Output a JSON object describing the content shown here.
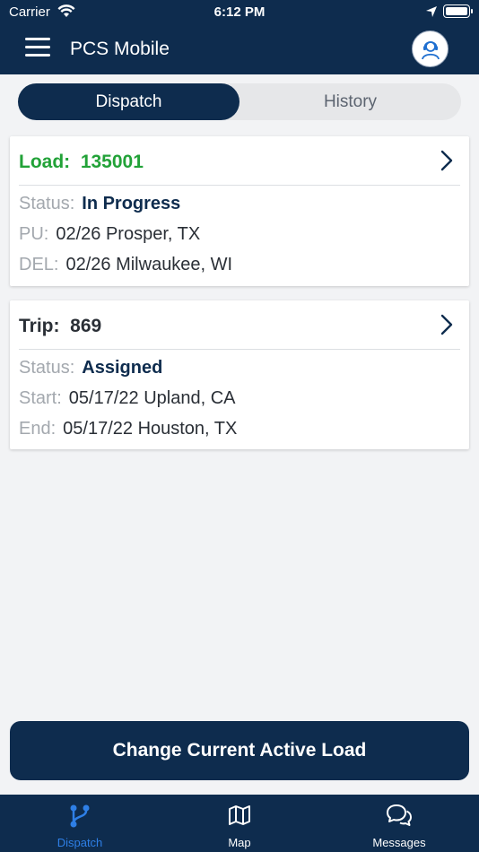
{
  "status_bar": {
    "carrier": "Carrier",
    "time": "6:12 PM"
  },
  "header": {
    "title": "PCS Mobile",
    "menu_icon": "hamburger-icon",
    "profile_icon": "user-support-icon"
  },
  "segments": {
    "dispatch": "Dispatch",
    "history": "History",
    "selected": "Dispatch"
  },
  "load_card": {
    "title_label": "Load:",
    "title_value": "135001",
    "title_color": "#22a238",
    "rows": [
      {
        "label": "Status:",
        "value": "In Progress"
      },
      {
        "label": "PU:",
        "value": "02/26 Prosper, TX"
      },
      {
        "label": "DEL:",
        "value": "02/26 Milwaukee, WI"
      }
    ]
  },
  "trip_card": {
    "title_label": "Trip:",
    "title_value": "869",
    "rows": [
      {
        "label": "Status:",
        "value": "Assigned"
      },
      {
        "label": "Start:",
        "value": "05/17/22 Upland, CA"
      },
      {
        "label": "End:",
        "value": "05/17/22 Houston, TX"
      }
    ]
  },
  "primary_button": {
    "label": "Change Current Active Load"
  },
  "tabbar": {
    "active_color": "#2e7fe6",
    "items": [
      {
        "label": "Dispatch",
        "icon": "route-icon",
        "active": true
      },
      {
        "label": "Map",
        "icon": "map-icon",
        "active": false
      },
      {
        "label": "Messages",
        "icon": "chat-bubbles-icon",
        "active": false
      }
    ]
  }
}
